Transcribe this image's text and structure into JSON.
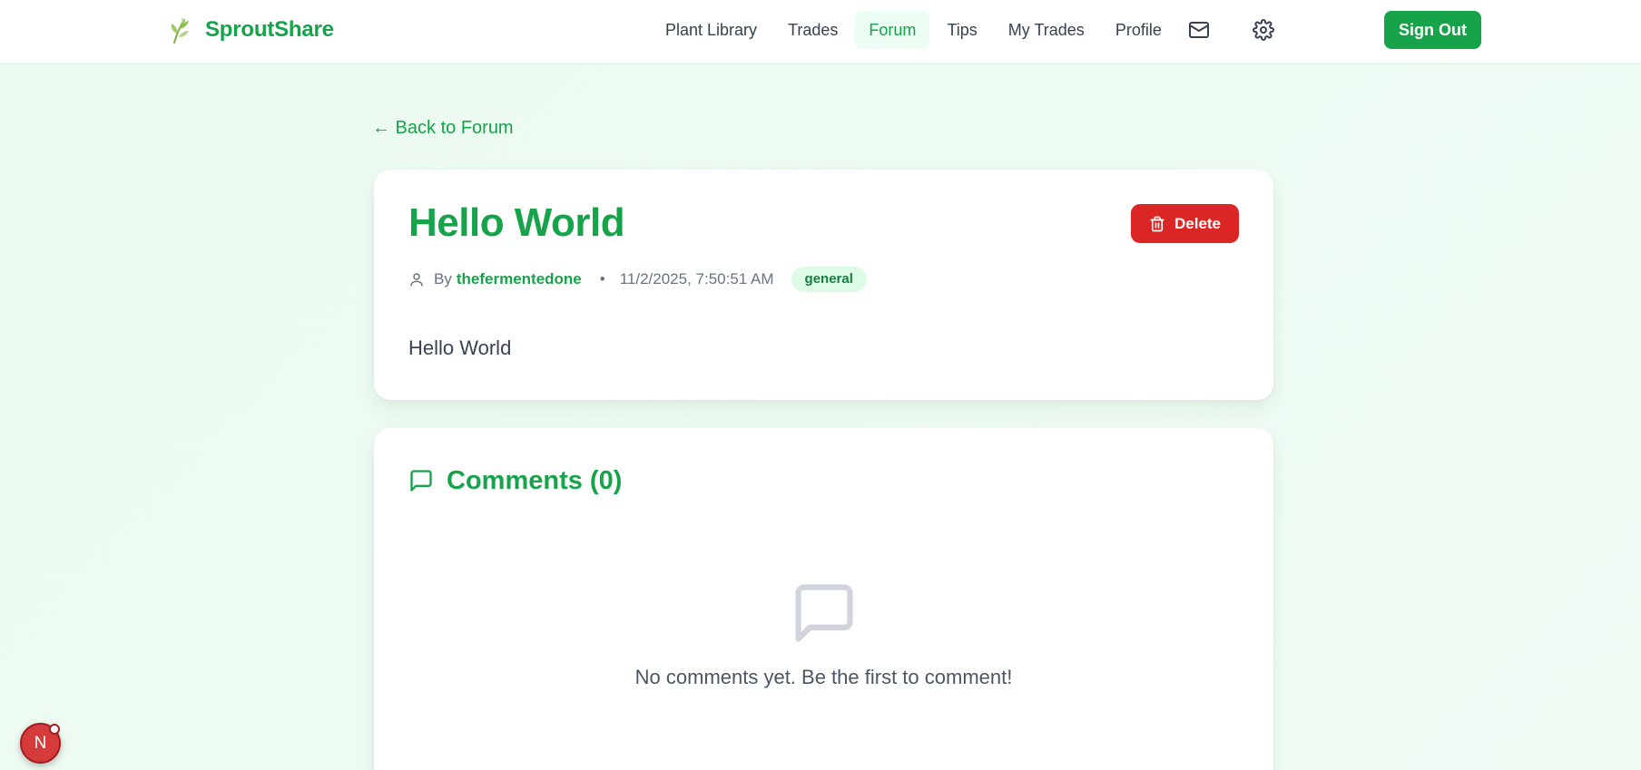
{
  "brand": {
    "name": "SproutShare",
    "icon": "sprout-icon"
  },
  "nav": {
    "items": [
      {
        "label": "Plant Library"
      },
      {
        "label": "Trades"
      },
      {
        "label": "Forum",
        "active": true
      },
      {
        "label": "Tips"
      },
      {
        "label": "My Trades"
      },
      {
        "label": "Profile"
      }
    ],
    "mail_icon": "mail-icon",
    "settings_icon": "gear-icon",
    "signout_label": "Sign Out"
  },
  "back_link": "← Back to Forum",
  "post": {
    "title": "Hello World",
    "delete_label": "Delete",
    "by_label": "By",
    "author": "thefermentedone",
    "separator": "•",
    "date": "11/2/2025, 7:50:51 AM",
    "tag": "general",
    "body": "Hello World"
  },
  "comments": {
    "title": "Comments (0)",
    "empty_text": "No comments yet. Be the first to comment!"
  },
  "dev_badge": {
    "letter": "N"
  },
  "colors": {
    "brand_green": "#16a34a",
    "danger_red": "#dc2626",
    "tag_bg": "#dcfce7"
  }
}
